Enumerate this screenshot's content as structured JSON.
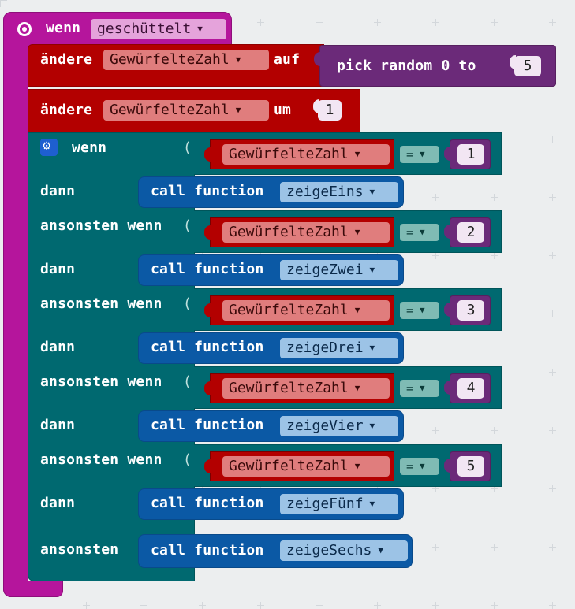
{
  "event": {
    "keyword": "wenn",
    "trigger": "geschüttelt"
  },
  "set1": {
    "keyword": "ändere",
    "variable": "GewürfelteZahl",
    "op": "auf"
  },
  "random": {
    "label": "pick random 0 to",
    "max": "5"
  },
  "set2": {
    "keyword": "ändere",
    "variable": "GewürfelteZahl",
    "op": "um",
    "value": "1"
  },
  "if": {
    "keyword": "wenn",
    "then": "dann",
    "elseif": "ansonsten wenn",
    "else": "ansonsten",
    "branches": [
      {
        "variable": "GewürfelteZahl",
        "op": "=",
        "value": "1",
        "call": "call function",
        "fn": "zeigeEins"
      },
      {
        "variable": "GewürfelteZahl",
        "op": "=",
        "value": "2",
        "call": "call function",
        "fn": "zeigeZwei"
      },
      {
        "variable": "GewürfelteZahl",
        "op": "=",
        "value": "3",
        "call": "call function",
        "fn": "zeigeDrei"
      },
      {
        "variable": "GewürfelteZahl",
        "op": "=",
        "value": "4",
        "call": "call function",
        "fn": "zeigeVier"
      },
      {
        "variable": "GewürfelteZahl",
        "op": "=",
        "value": "5",
        "call": "call function",
        "fn": "zeigeFünf"
      }
    ],
    "else_call": {
      "call": "call function",
      "fn": "zeigeSechs"
    }
  },
  "colors": {
    "event": "#b5159c",
    "variables": "#b30000",
    "logic": "#006970",
    "functions": "#0b59a5",
    "math": "#6b2a79",
    "workspace": "#eceeef"
  },
  "icons": {
    "event_icon": "radio-target-icon",
    "if_icon": "gear-icon",
    "dropdown": "triangle-down-icon"
  }
}
